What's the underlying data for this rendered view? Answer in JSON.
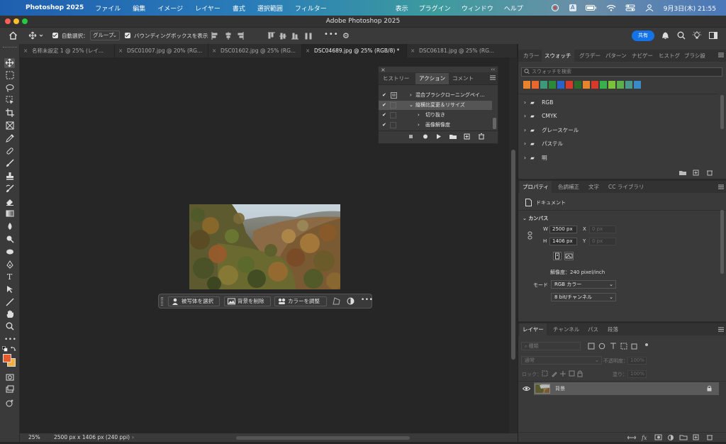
{
  "menubar": {
    "app_name": "Photoshop 2025",
    "menus": [
      "ファイル",
      "編集",
      "イメージ",
      "レイヤー",
      "書式",
      "選択範囲",
      "フィルター"
    ],
    "right_menus": [
      "表示",
      "プラグイン",
      "ウィンドウ",
      "ヘルプ"
    ],
    "input_mode": "A",
    "datetime": "9月3日(木)  21:55"
  },
  "window": {
    "title": "Adobe Photoshop 2025"
  },
  "options_bar": {
    "auto_select_label": "自動選択：",
    "auto_select_value": "グループ",
    "bounding_box_label": "バウンディングボックスを表示",
    "share_label": "共有"
  },
  "doc_tabs": [
    {
      "label": "名称未設定 1 @ 25% (レイ...",
      "active": false
    },
    {
      "label": "DSC01007.jpg @ 20% (RG...",
      "active": false
    },
    {
      "label": "DSC01602.jpg @ 25% (RG...",
      "active": false
    },
    {
      "label": "DSC04689.jpg @ 25% (RGB/8) *",
      "active": true
    },
    {
      "label": "DSC06181.jpg @ 25% (RG...",
      "active": false
    }
  ],
  "contextual_bar": {
    "select_subject": "被写体を選択",
    "remove_bg": "背景を削除",
    "adjust_color": "カラーを調整"
  },
  "actions_panel": {
    "tabs": [
      "ヒストリー",
      "アクション",
      "コメント"
    ],
    "active_tab": "アクション",
    "rows": [
      {
        "label": "混合ブラシクローニングペイ...",
        "level": 1,
        "expanded": false
      },
      {
        "label": "縦横比変更＆リサイズ",
        "level": 1,
        "expanded": true,
        "selected": true
      },
      {
        "label": "切り抜き",
        "level": 2,
        "expanded": false
      },
      {
        "label": "画像解像度",
        "level": 2,
        "expanded": false
      }
    ]
  },
  "swatches_panel": {
    "tabs": [
      "カラー",
      "スウォッチ",
      "グラデー",
      "パターン",
      "ナビゲー",
      "ヒストグ",
      "ブラシ設"
    ],
    "active_tab": "スウォッチ",
    "search_placeholder": "スウォッチを検索",
    "recent_colors": [
      "#e8842c",
      "#e8682c",
      "#3a9a7a",
      "#2a8a3a",
      "#2a62c8",
      "#d83a2a",
      "#2a6a2a",
      "#e8842c",
      "#d83a2a",
      "#3ab04a",
      "#7ac23a",
      "#5ab04a",
      "#4a9a8a",
      "#3a8ac8"
    ],
    "groups": [
      "RGB",
      "CMYK",
      "グレースケール",
      "パステル",
      "明"
    ]
  },
  "properties_panel": {
    "tabs": [
      "プロパティ",
      "色調補正",
      "文字",
      "CC ライブラリ"
    ],
    "active_tab": "プロパティ",
    "doc_label": "ドキュメント",
    "section": "カンバス",
    "w_label": "W",
    "w_value": "2500 px",
    "h_label": "H",
    "h_value": "1406 px",
    "x_label": "X",
    "x_value": "0 px",
    "y_label": "Y",
    "y_value": "0 px",
    "resolution": "解像度：240 pixel/inch",
    "mode_label": "モード",
    "mode_value": "RGB カラー",
    "bitdepth_value": "8 bit/チャンネル"
  },
  "layers_panel": {
    "tabs": [
      "レイヤー",
      "チャンネル",
      "パス",
      "段落"
    ],
    "active_tab": "レイヤー",
    "filter_placeholder": "種類",
    "blend_mode": "通常",
    "opacity_label": "不透明度：",
    "opacity_value": "100%",
    "lock_label": "ロック：",
    "fill_label": "塗り：",
    "fill_value": "100%",
    "layers": [
      {
        "name": "背景",
        "visible": true,
        "locked": true
      }
    ]
  },
  "status": {
    "zoom": "25%",
    "doc_info": "2500 px x 1406 px (240 ppi)"
  }
}
